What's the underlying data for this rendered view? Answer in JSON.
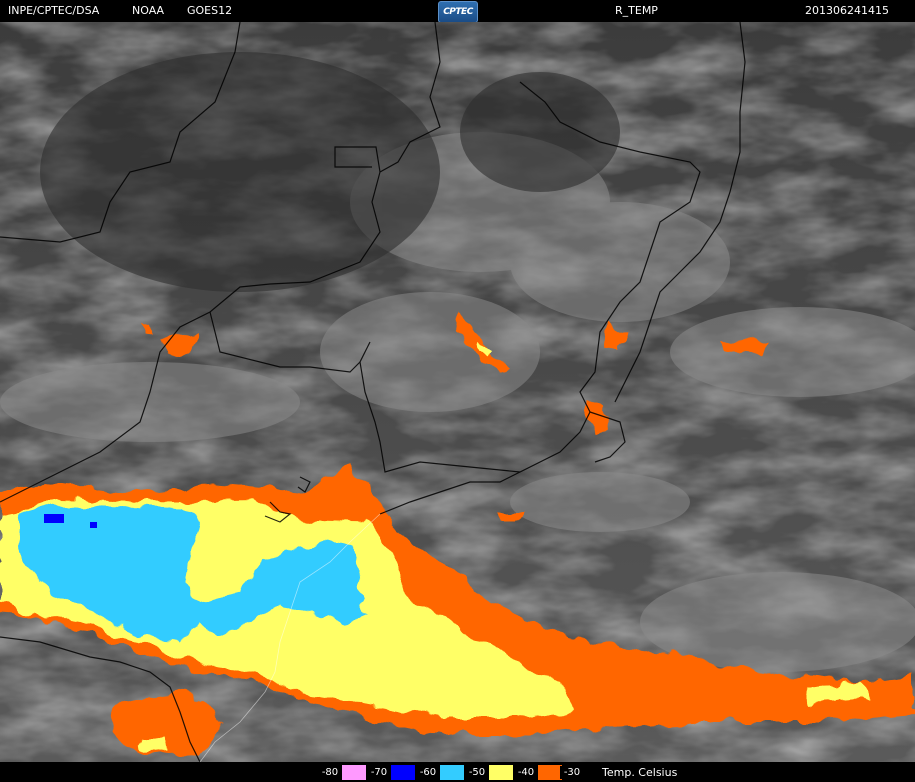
{
  "header": {
    "source": "INPE/CPTEC/DSA",
    "agency": "NOAA",
    "satellite": "GOES12",
    "logo_text": "CPTEC",
    "product": "R_TEMP",
    "timestamp": "201306241415"
  },
  "legend": {
    "items": [
      {
        "label": "-80",
        "color": "#ff99ff"
      },
      {
        "label": "-70",
        "color": "#0000ff"
      },
      {
        "label": "-60",
        "color": "#00ccff"
      },
      {
        "label": "-50",
        "color": "#ffff66"
      },
      {
        "label": "-40",
        "color": "#ff6600"
      },
      {
        "label": "-30",
        "color": "#ff6600"
      }
    ],
    "unit_label": "Temp. Celsius"
  },
  "colors": {
    "background": "#000000",
    "cloud_gray": "#6e6e6e",
    "land_dark": "#3a3a3a",
    "border_line": "#000000",
    "cold_orange": "#ff6600",
    "cold_yellow": "#ffff66",
    "cold_cyan": "#33ccff",
    "cold_blue": "#0000ff"
  }
}
